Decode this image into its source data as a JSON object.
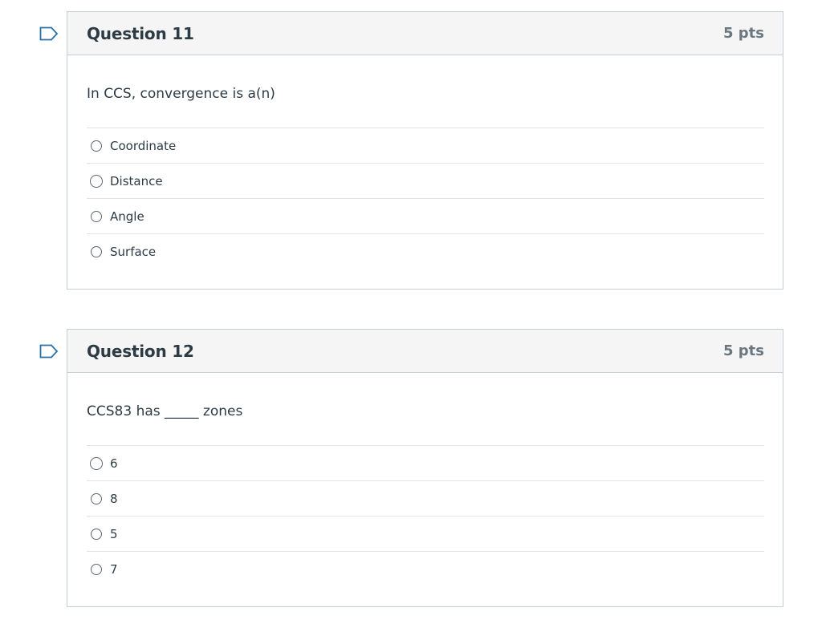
{
  "questions": [
    {
      "title": "Question 11",
      "points": "5 pts",
      "text": "In CCS, convergence is a(n)",
      "answers": [
        "Coordinate",
        "Distance",
        "Angle",
        "Surface"
      ]
    },
    {
      "title": "Question 12",
      "points": "5 pts",
      "text": "CCS83 has _____ zones",
      "answers": [
        "6",
        "8",
        "5",
        "7"
      ]
    }
  ],
  "colors": {
    "flag": "#2d6fa3",
    "header_bg": "#f5f5f5",
    "border": "#c7cdd1",
    "text": "#2d3b45",
    "points": "#6b7780"
  },
  "icons": {
    "flag": "bookmark-flag-icon",
    "radio": "radio-button-unchecked"
  }
}
